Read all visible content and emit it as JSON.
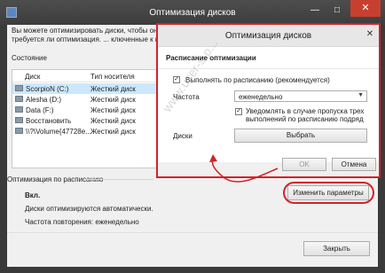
{
  "back_window": {
    "title": "Оптимизация дисков",
    "min_glyph": "—",
    "max_glyph": "□",
    "close_glyph": "✕",
    "description": "Вы можете оптимизировать диски, чтобы они работали эффективнее, или проанализировать их, чтобы увидеть, требуется ли оптимизация. Показаны только диски, подключенные к компьютеру или подключенные к нему.",
    "description_visible": "Вы можете оптимизировать диски, чтобы они ..., чтобы увидеть, требуется ли оптимизация. ... ключенные к нему.",
    "status_label": "Состояние",
    "list": {
      "columns": [
        "Диск",
        "Тип носителя"
      ],
      "rows": [
        {
          "name": "ScorpioN (C:)",
          "type": "Жесткий диск"
        },
        {
          "name": "Alesha (D:)",
          "type": "Жесткий диск"
        },
        {
          "name": "Data (F:)",
          "type": "Жесткий диск"
        },
        {
          "name": "Восстановить",
          "type": "Жесткий диск"
        },
        {
          "name": "\\\\?\\Volume{47728e...",
          "type": "Жесткий диск"
        }
      ]
    },
    "schedule_title": "Оптимизация по расписанию",
    "schedule_state": "Вкл.",
    "schedule_auto": "Диски оптимизируются автоматически.",
    "schedule_freq": "Частота повторения: еженедельно",
    "change_button": "Изменить параметры",
    "close_button": "Закрыть"
  },
  "dialog": {
    "title": "Оптимизация дисков",
    "close_glyph": "✕",
    "section_header": "Расписание оптимизации",
    "run_scheduled_label": "Выполнять по расписанию (рекомендуется)",
    "run_scheduled_checked": true,
    "frequency_label": "Частота",
    "frequency_value": "еженедельно",
    "notify_label": "Уведомлять в случае пропуска трех выполнений по расписанию подряд",
    "notify_checked": true,
    "disks_label": "Диски",
    "choose_button": "Выбрать",
    "ok_button": "OK",
    "cancel_button": "Отмена"
  },
  "watermark": "www.user-s-p...",
  "colors": {
    "accent_red": "#d2232a",
    "titlebar": "#3d3d3d",
    "close_red": "#c7402f"
  }
}
